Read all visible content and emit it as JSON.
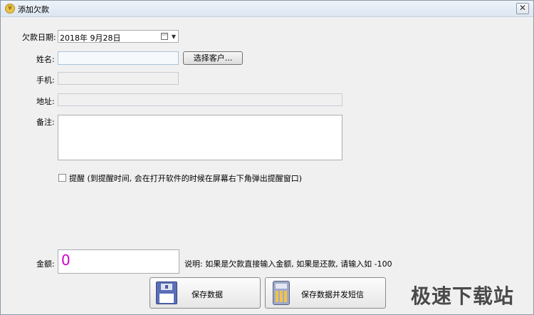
{
  "window": {
    "title": "添加欠款",
    "close_symbol": "✕"
  },
  "form": {
    "date_label": "欠款日期:",
    "date_value": "2018年  9月28日",
    "name_label": "姓名:",
    "name_value": "",
    "select_customer_label": "选择客户...",
    "phone_label": "手机:",
    "phone_value": "",
    "address_label": "地址:",
    "address_value": "",
    "remark_label": "备注:",
    "remark_value": "",
    "reminder_label": "提醒 (到提醒时间, 会在打开软件的时候在屏幕右下角弹出提醒窗口)",
    "reminder_checked": false,
    "amount_label": "金额:",
    "amount_value": "0",
    "amount_color": "#d400c8",
    "note": "说明: 如果是欠款直接输入金额, 如果是还款, 请输入如  -100"
  },
  "buttons": {
    "save": "保存数据",
    "save_sms": "保存数据并发短信"
  },
  "watermark": "极速下载站"
}
